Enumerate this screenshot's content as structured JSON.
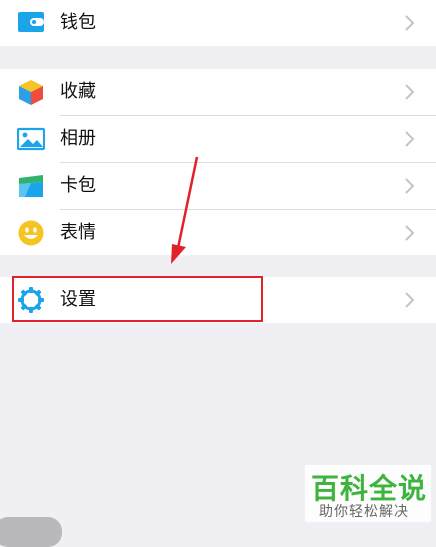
{
  "menu": {
    "wallet": {
      "label": "钱包",
      "icon": "wallet-icon"
    },
    "favorites": {
      "label": "收藏",
      "icon": "cube-icon"
    },
    "album": {
      "label": "相册",
      "icon": "picture-icon"
    },
    "cards": {
      "label": "卡包",
      "icon": "card-icon"
    },
    "stickers": {
      "label": "表情",
      "icon": "smiley-icon"
    },
    "settings": {
      "label": "设置",
      "icon": "gear-icon"
    }
  },
  "annotation": {
    "color": "#e2222a"
  },
  "watermark": {
    "title": "百科全说",
    "subtitle": "助你轻松解决"
  },
  "colors": {
    "accent": "#1aa4ea",
    "background": "#efeff4",
    "watermark_green": "#3db43d"
  }
}
